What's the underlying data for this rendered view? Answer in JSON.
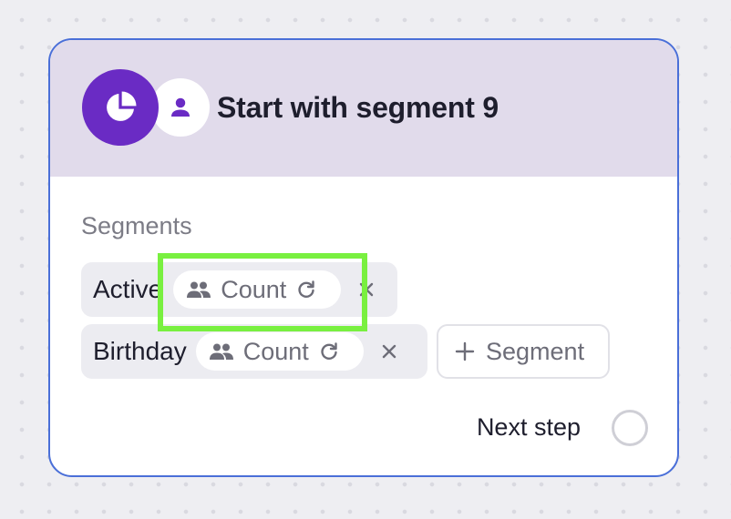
{
  "card": {
    "title": "Start with segment 9",
    "section_label": "Segments",
    "segments": [
      {
        "name": "Active",
        "count_label": "Count"
      },
      {
        "name": "Birthday",
        "count_label": "Count"
      }
    ],
    "add_segment_label": "Segment",
    "next_step_label": "Next step"
  },
  "icons": {
    "header_primary": "pie-chart-icon",
    "header_secondary": "user-icon",
    "count": "people-icon",
    "refresh": "refresh-icon",
    "remove": "close-icon",
    "add": "plus-icon"
  },
  "colors": {
    "card_border": "#4a6fd8",
    "header_bg": "#e1dbeb",
    "accent_purple": "#6a2bc4",
    "highlight": "#79f040"
  }
}
